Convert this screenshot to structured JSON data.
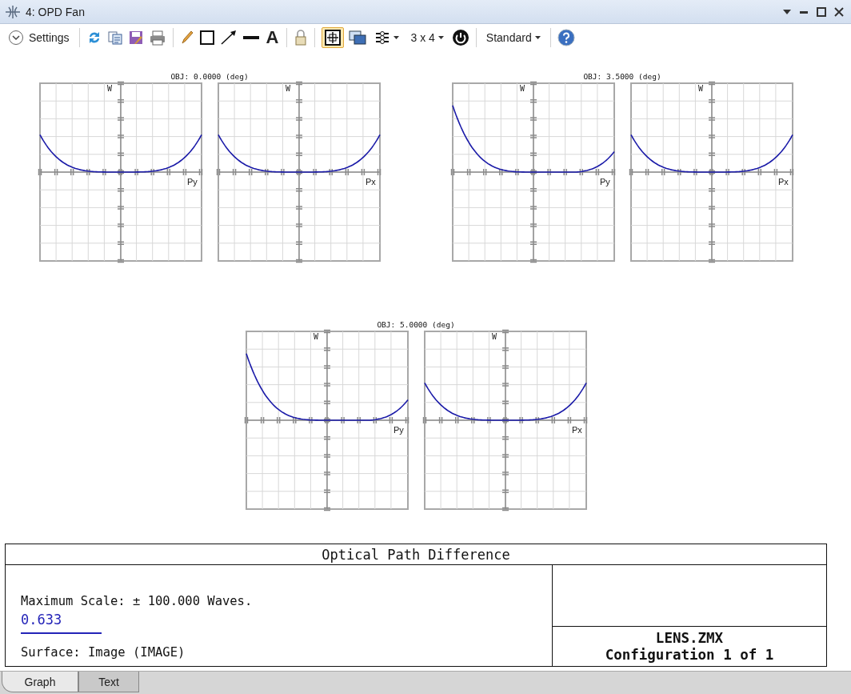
{
  "window": {
    "title": "4: OPD Fan"
  },
  "toolbar": {
    "settings": "Settings",
    "text_tool": "A",
    "auto_fit_on": true,
    "layout": "3 x 4",
    "style": "Standard"
  },
  "fan_groups": [
    {
      "title": "OBJ: 0.0000 (deg)",
      "fans": [
        {
          "y_label": "W",
          "x_label": "Py",
          "kind": "even"
        },
        {
          "y_label": "W",
          "x_label": "Px",
          "kind": "even"
        }
      ]
    },
    {
      "title": "OBJ: 3.5000 (deg)",
      "fans": [
        {
          "y_label": "W",
          "x_label": "Py",
          "kind": "skewed"
        },
        {
          "y_label": "W",
          "x_label": "Px",
          "kind": "even"
        }
      ]
    },
    {
      "title": "OBJ: 5.0000 (deg)",
      "fans": [
        {
          "y_label": "W",
          "x_label": "Py",
          "kind": "skewed"
        },
        {
          "y_label": "W",
          "x_label": "Px",
          "kind": "even"
        }
      ]
    }
  ],
  "info": {
    "title": "Optical Path Difference",
    "scale": "Maximum Scale: ± 100.000 Waves.",
    "wavelength": "0.633",
    "surface": "Surface: Image (IMAGE)",
    "file": "LENS.ZMX",
    "configuration": "Configuration 1 of 1"
  },
  "tabs": [
    {
      "label": "Graph",
      "selected": true
    },
    {
      "label": "Text",
      "selected": false
    }
  ]
}
